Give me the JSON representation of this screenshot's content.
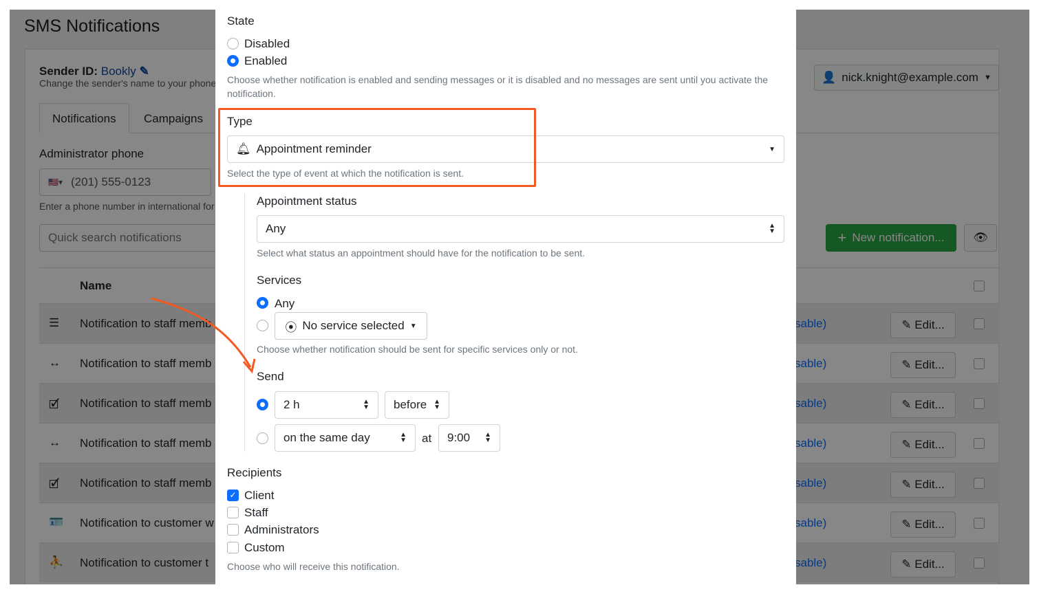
{
  "page": {
    "title": "SMS Notifications",
    "sender_label": "Sender ID:",
    "sender_value": "Bookly",
    "sender_help": "Change the sender's name to your phone",
    "user": "nick.knight@example.com",
    "tabs": [
      {
        "label": "Notifications"
      },
      {
        "label": "Campaigns"
      }
    ],
    "admin_phone_label": "Administrator phone",
    "admin_phone_value": "(201) 555-0123",
    "admin_phone_help": "Enter a phone number in international for",
    "search_placeholder": "Quick search notifications",
    "new_button": "New notification...",
    "column_name": "Name",
    "rows": [
      {
        "icon": "list-icon",
        "name": "Notification to staff memb",
        "status": "sable)",
        "edit": "Edit..."
      },
      {
        "icon": "arrows-h-icon",
        "name": "Notification to staff memb",
        "status": "sable)",
        "edit": "Edit..."
      },
      {
        "icon": "calendar-check-icon",
        "name": "Notification to staff memb",
        "status": "sable)",
        "edit": "Edit..."
      },
      {
        "icon": "arrows-h-icon",
        "name": "Notification to staff memb",
        "status": "sable)",
        "edit": "Edit..."
      },
      {
        "icon": "calendar-check-icon",
        "name": "Notification to staff memb",
        "status": "sable)",
        "edit": "Edit..."
      },
      {
        "icon": "id-card-icon",
        "name": "Notification to customer w",
        "status": "sable)",
        "edit": "Edit..."
      },
      {
        "icon": "street-view-icon",
        "name": "Notification to customer t",
        "status": "sable)",
        "edit": "Edit..."
      }
    ]
  },
  "modal": {
    "state": {
      "label": "State",
      "options": [
        "Disabled",
        "Enabled"
      ],
      "selected": "Enabled",
      "help": "Choose whether notification is enabled and sending messages or it is disabled and no messages are sent until you activate the notification."
    },
    "type": {
      "label": "Type",
      "value": "Appointment reminder",
      "help": "Select the type of event at which the notification is sent."
    },
    "appointment_status": {
      "label": "Appointment status",
      "value": "Any",
      "help": "Select what status an appointment should have for the notification to be sent."
    },
    "services": {
      "label": "Services",
      "any": "Any",
      "specific": "No service selected",
      "selected": "Any",
      "help": "Choose whether notification should be sent for specific services only or not."
    },
    "send": {
      "label": "Send",
      "offset": "2 h",
      "direction": "before",
      "day": "on the same day",
      "at": "at",
      "time": "9:00",
      "selected": "offset"
    },
    "recipients": {
      "label": "Recipients",
      "options": [
        {
          "label": "Client",
          "checked": true
        },
        {
          "label": "Staff",
          "checked": false
        },
        {
          "label": "Administrators",
          "checked": false
        },
        {
          "label": "Custom",
          "checked": false
        }
      ],
      "help": "Choose who will receive this notification."
    }
  },
  "colors": {
    "highlight": "#f15a22",
    "primary": "#0d6efd",
    "green": "#28a745"
  }
}
